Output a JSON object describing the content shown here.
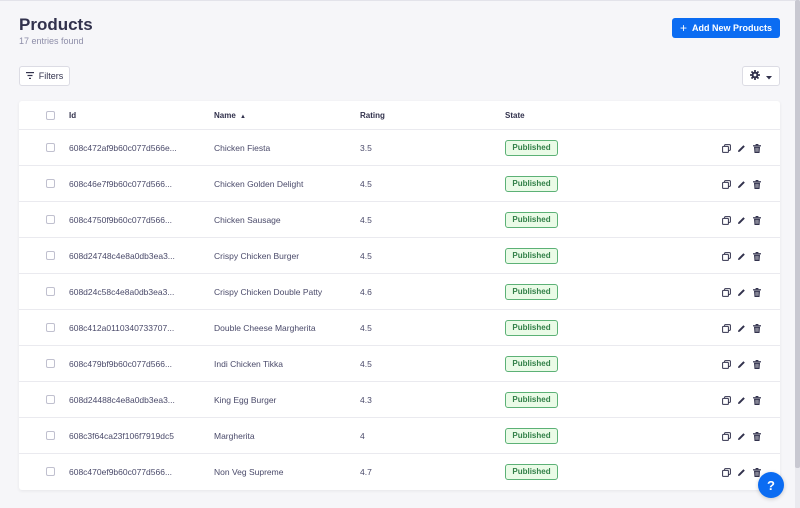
{
  "header": {
    "title": "Products",
    "subtitle": "17 entries found",
    "add_button_label": "Add New Products"
  },
  "toolbar": {
    "filters_label": "Filters"
  },
  "table": {
    "columns": [
      "Id",
      "Name",
      "Rating",
      "State"
    ],
    "sort": {
      "column": "Name",
      "direction": "ascending"
    },
    "rows": [
      {
        "id": "608c472af9b60c077d566e...",
        "name": "Chicken Fiesta",
        "rating": "3.5",
        "state": "Published"
      },
      {
        "id": "608c46e7f9b60c077d566...",
        "name": "Chicken Golden Delight",
        "rating": "4.5",
        "state": "Published"
      },
      {
        "id": "608c4750f9b60c077d566...",
        "name": "Chicken Sausage",
        "rating": "4.5",
        "state": "Published"
      },
      {
        "id": "608d24748c4e8a0db3ea3...",
        "name": "Crispy Chicken Burger",
        "rating": "4.5",
        "state": "Published"
      },
      {
        "id": "608d24c58c4e8a0db3ea3...",
        "name": "Crispy Chicken Double Patty",
        "rating": "4.6",
        "state": "Published"
      },
      {
        "id": "608c412a0110340733707...",
        "name": "Double Cheese Margherita",
        "rating": "4.5",
        "state": "Published"
      },
      {
        "id": "608c479bf9b60c077d566...",
        "name": "Indi Chicken Tikka",
        "rating": "4.5",
        "state": "Published"
      },
      {
        "id": "608d24488c4e8a0db3ea3...",
        "name": "King Egg Burger",
        "rating": "4.3",
        "state": "Published"
      },
      {
        "id": "608c3f64ca23f106f7919dc5",
        "name": "Margherita",
        "rating": "4",
        "state": "Published"
      },
      {
        "id": "608c470ef9b60c077d566...",
        "name": "Non Veg Supreme",
        "rating": "4.7",
        "state": "Published"
      }
    ]
  },
  "help": {
    "label": "?"
  },
  "colors": {
    "primary": "#0b6cf2",
    "badge_bg": "#eafbe7",
    "badge_border": "#5cb176",
    "badge_text": "#328048",
    "background": "#f6f6f9"
  },
  "icons": {
    "add": "plus-icon",
    "filter": "filter-icon",
    "settings": "gear-icon",
    "dropdown": "caret-down-icon",
    "sort": "sort-ascending-icon",
    "duplicate": "duplicate-icon",
    "edit": "pencil-icon",
    "delete": "trash-icon",
    "help": "question-icon"
  }
}
